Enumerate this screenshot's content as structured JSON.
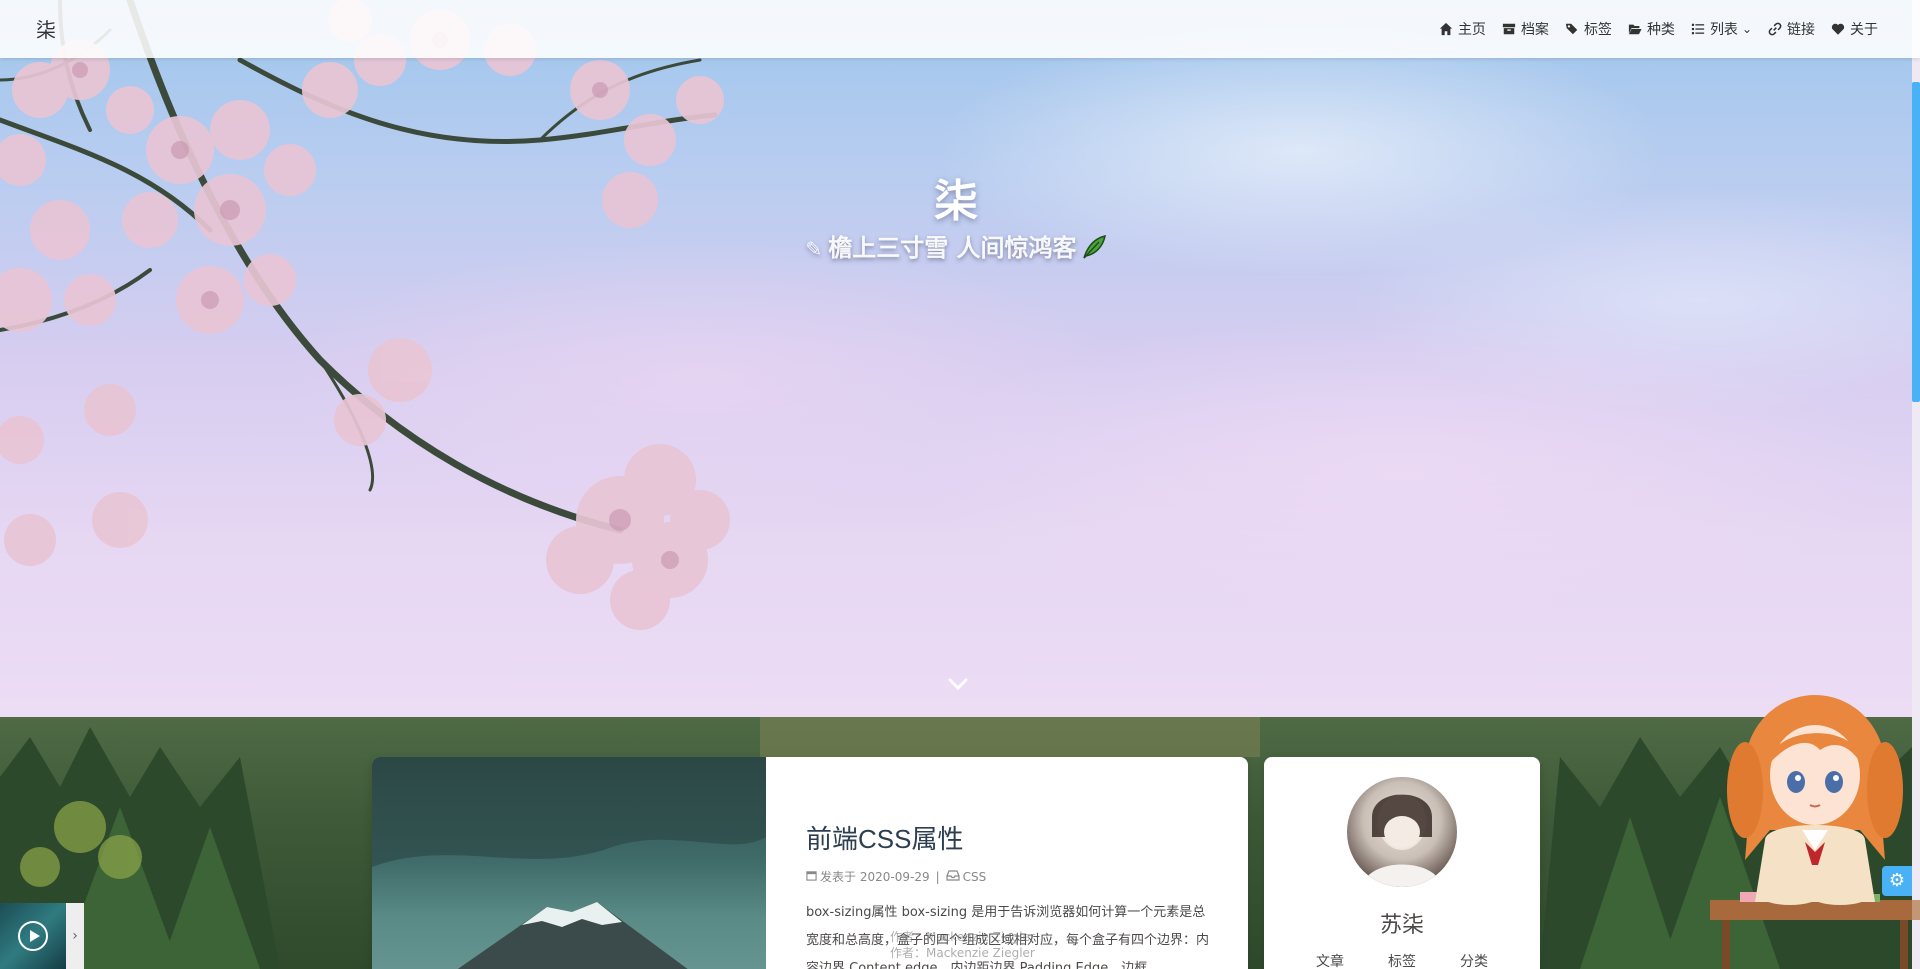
{
  "navbar": {
    "brand": "柒",
    "items": [
      {
        "label": "主页",
        "icon": "home-icon"
      },
      {
        "label": "档案",
        "icon": "archive-icon"
      },
      {
        "label": "标签",
        "icon": "tags-icon"
      },
      {
        "label": "种类",
        "icon": "folder-open-icon"
      },
      {
        "label": "列表",
        "icon": "list-icon"
      },
      {
        "label": "链接",
        "icon": "link-icon"
      },
      {
        "label": "关于",
        "icon": "heart-icon"
      }
    ]
  },
  "hero": {
    "title": "柒",
    "subtitle": "檐上三寸雪 人间惊鸿客"
  },
  "post": {
    "title": "前端CSS属性",
    "meta_prefix": "发表于",
    "date": "2020-09-29",
    "separator": "|",
    "category": "CSS",
    "excerpt": "box-sizing属性 box-sizing 是用于告诉浏览器如何计算一个元素是总宽度和总高度，盒子的四个组成区域相对应，每个盒子有四个边界：内容边界 Content edge、内边距边界 Padding Edge、边框..."
  },
  "watermark": {
    "line1": "作者：Mackenzie Ziegler",
    "line2": "作者：Mackenzie Ziegler"
  },
  "author": {
    "name": "苏柒",
    "stats": [
      "文章",
      "标签",
      "分类"
    ]
  },
  "colors": {
    "accent": "#49b1f5",
    "title": "#2c3e50"
  }
}
